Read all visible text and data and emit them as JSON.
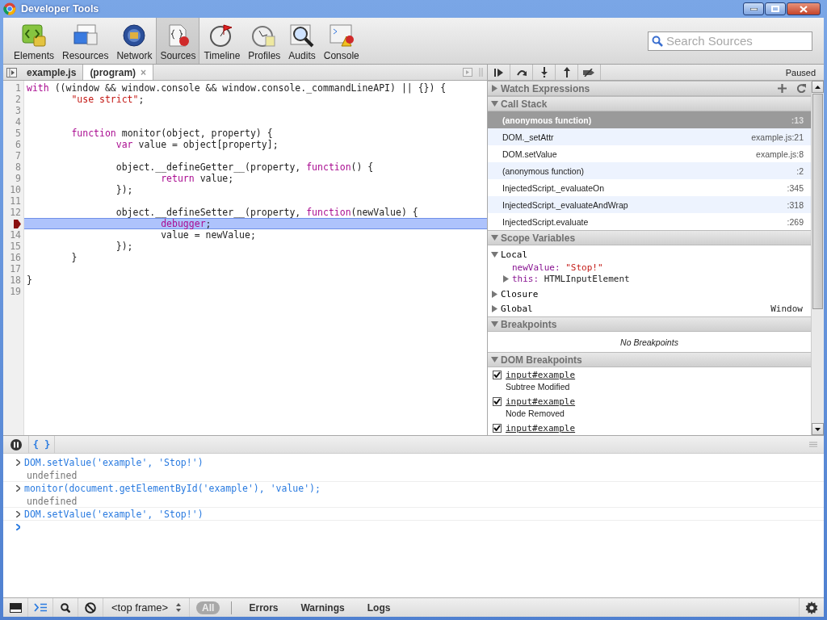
{
  "window": {
    "title": "Developer Tools"
  },
  "toolbar": {
    "items": [
      {
        "label": "Elements",
        "selected": false
      },
      {
        "label": "Resources",
        "selected": false
      },
      {
        "label": "Network",
        "selected": false
      },
      {
        "label": "Sources",
        "selected": true
      },
      {
        "label": "Timeline",
        "selected": false
      },
      {
        "label": "Profiles",
        "selected": false
      },
      {
        "label": "Audits",
        "selected": false
      },
      {
        "label": "Console",
        "selected": false
      }
    ],
    "search": {
      "placeholder": "Search Sources"
    }
  },
  "editor": {
    "tabs": [
      {
        "label": "example.js",
        "selected": false,
        "closable": false
      },
      {
        "label": "(program)",
        "selected": true,
        "closable": true,
        "close_glyph": "×"
      }
    ],
    "lines": [
      {
        "number": "1",
        "current": false,
        "tokens": [
          {
            "kind": "keyword",
            "t": "with"
          },
          {
            "kind": "plain",
            "t": " ((window && window.console && window.console._commandLineAPI) || {}) {"
          }
        ]
      },
      {
        "number": "2",
        "current": false,
        "tokens": [
          {
            "kind": "string",
            "t": "        \"use strict\""
          },
          {
            "kind": "plain",
            "t": ";"
          }
        ]
      },
      {
        "number": "3",
        "current": false
      },
      {
        "number": "4",
        "current": false
      },
      {
        "number": "5",
        "current": false,
        "tokens": [
          {
            "kind": "keyword",
            "t": "        function"
          },
          {
            "kind": "plain",
            "t": " monitor(object, property) {"
          }
        ]
      },
      {
        "number": "6",
        "current": false,
        "tokens": [
          {
            "kind": "keyword",
            "t": "                var"
          },
          {
            "kind": "plain",
            "t": " value = object[property];"
          }
        ]
      },
      {
        "number": "7",
        "current": false
      },
      {
        "number": "8",
        "current": false,
        "tokens": [
          {
            "kind": "plain",
            "t": "                object.__defineGetter__(property, "
          },
          {
            "kind": "keyword",
            "t": "function"
          },
          {
            "kind": "plain",
            "t": "() {"
          }
        ]
      },
      {
        "number": "9",
        "current": false,
        "tokens": [
          {
            "kind": "keyword",
            "t": "                        return"
          },
          {
            "kind": "plain",
            "t": " value;"
          }
        ]
      },
      {
        "number": "10",
        "current": false,
        "tokens": [
          {
            "kind": "plain",
            "t": "                });"
          }
        ]
      },
      {
        "number": "11",
        "current": false
      },
      {
        "number": "12",
        "current": false,
        "tokens": [
          {
            "kind": "plain",
            "t": "                object.__defineSetter__(property, "
          },
          {
            "kind": "keyword",
            "t": "function"
          },
          {
            "kind": "plain",
            "t": "(newValue) {"
          }
        ]
      },
      {
        "current": true,
        "tokens": [
          {
            "kind": "keyword",
            "t": "                        debugger"
          },
          {
            "kind": "plain",
            "t": ";"
          }
        ]
      },
      {
        "number": "14",
        "current": false,
        "tokens": [
          {
            "kind": "plain",
            "t": "                        value = newValue;"
          }
        ]
      },
      {
        "number": "15",
        "current": false,
        "tokens": [
          {
            "kind": "plain",
            "t": "                });"
          }
        ]
      },
      {
        "number": "16",
        "current": false,
        "tokens": [
          {
            "kind": "plain",
            "t": "        }"
          }
        ]
      },
      {
        "number": "17",
        "current": false
      },
      {
        "number": "18",
        "current": false,
        "tokens": [
          {
            "kind": "plain",
            "t": "}"
          }
        ]
      },
      {
        "number": "19",
        "current": false
      }
    ]
  },
  "debugger": {
    "status": "Paused",
    "watch": {
      "title": "Watch Expressions",
      "expanded": false
    },
    "call_stack": {
      "title": "Call Stack",
      "expanded": true,
      "frames": [
        {
          "name": "(anonymous function)",
          "location": ":13",
          "selected": true
        },
        {
          "name": "DOM._setAttr",
          "location": "example.js:21",
          "selected": false
        },
        {
          "name": "DOM.setValue",
          "location": "example.js:8",
          "selected": false
        },
        {
          "name": "(anonymous function)",
          "location": ":2",
          "selected": false
        },
        {
          "name": "InjectedScript._evaluateOn",
          "location": ":345",
          "selected": false
        },
        {
          "name": "InjectedScript._evaluateAndWrap",
          "location": ":318",
          "selected": false
        },
        {
          "name": "InjectedScript.evaluate",
          "location": ":269",
          "selected": false
        }
      ]
    },
    "scope": {
      "title": "Scope Variables",
      "expanded": true,
      "items": [
        {
          "name": "Local",
          "expanded": true,
          "children": [
            {
              "name": "newValue:",
              "value": "\"Stop!\"",
              "kind": "string"
            },
            {
              "name": "this:",
              "value": "HTMLInputElement",
              "kind": "object",
              "expanded": false
            }
          ]
        },
        {
          "name": "Closure",
          "expanded": false
        },
        {
          "name": "Global",
          "expanded": false,
          "value": "Window"
        }
      ]
    },
    "breakpoints": {
      "title": "Breakpoints",
      "expanded": true,
      "empty_text": "No Breakpoints"
    },
    "dom_breakpoints": {
      "title": "DOM Breakpoints",
      "expanded": true,
      "items": [
        {
          "node": "input#example",
          "type": "Subtree Modified",
          "checked": true
        },
        {
          "node": "input#example",
          "type": "Node Removed",
          "checked": true
        },
        {
          "node": "input#example",
          "checked": true
        }
      ]
    }
  },
  "console": {
    "pretty_print": "{ }",
    "entries": [
      {
        "kind": "input",
        "text": "DOM.setValue('example', 'Stop!')"
      },
      {
        "kind": "output",
        "text": "undefined"
      },
      {
        "kind": "input",
        "text": "monitor(document.getElementById('example'), 'value');"
      },
      {
        "kind": "output",
        "text": "undefined"
      },
      {
        "kind": "input",
        "text": "DOM.setValue('example', 'Stop!')"
      }
    ]
  },
  "status_bar": {
    "frame": "<top frame>",
    "filters": [
      {
        "label": "All",
        "selected": true
      },
      {
        "label": "Errors",
        "selected": false
      },
      {
        "label": "Warnings",
        "selected": false
      },
      {
        "label": "Logs",
        "selected": false
      }
    ]
  }
}
